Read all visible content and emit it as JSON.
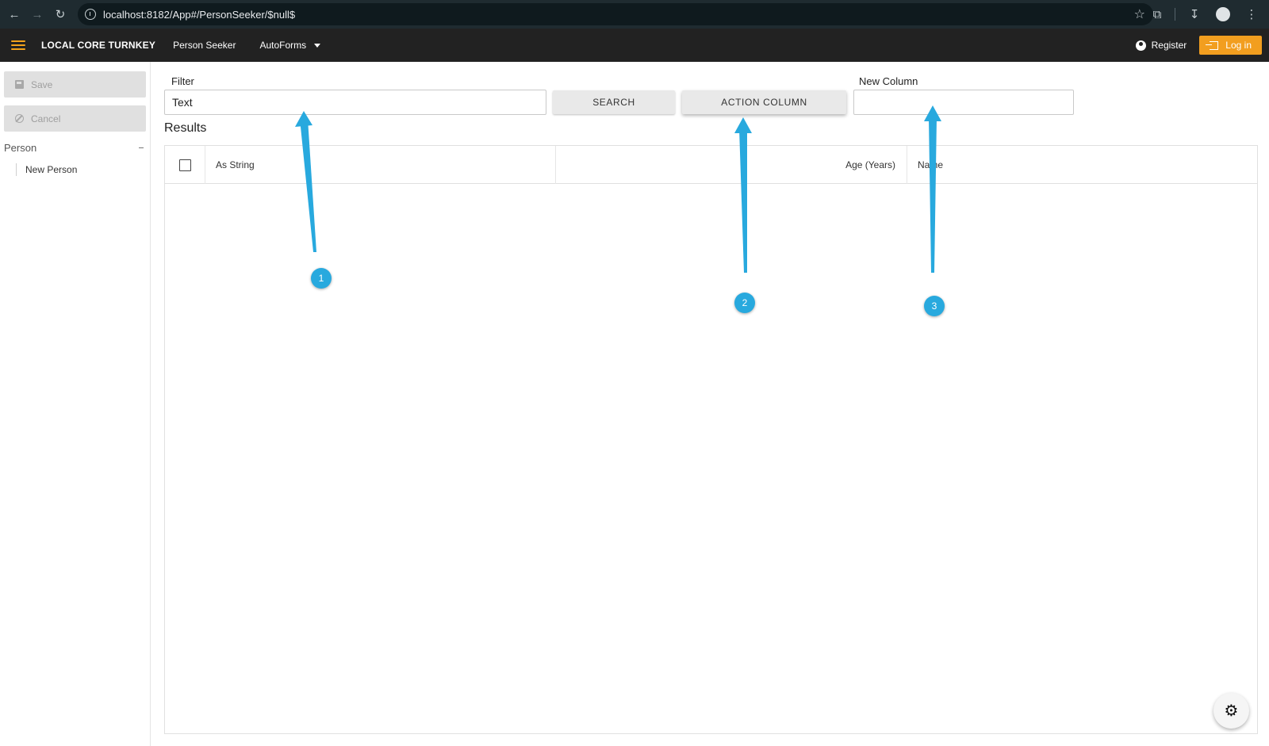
{
  "browser": {
    "url": "localhost:8182/App#/PersonSeeker/$null$",
    "icons": [
      "back-arrow-icon",
      "forward-arrow-icon",
      "reload-icon",
      "site-info-icon",
      "star-icon",
      "extensions-icon",
      "download-icon",
      "profile-icon",
      "more-vert-icon"
    ]
  },
  "appbar": {
    "brand": "LOCAL CORE TURNKEY",
    "nav_person_seeker": "Person Seeker",
    "nav_autoforms": "AutoForms",
    "register": "Register",
    "login": "Log in",
    "accent_color": "#f29e1f"
  },
  "sidebar": {
    "save": "Save",
    "cancel": "Cancel",
    "section": "Person",
    "items": [
      {
        "label": "New Person"
      }
    ]
  },
  "main": {
    "filter_label": "Filter",
    "filter_value": "Text",
    "search_button": "SEARCH",
    "action_column_button": "ACTION COLUMN",
    "new_column_label": "New Column",
    "new_column_value": "",
    "results_title": "Results",
    "columns": [
      "As String",
      "Age (Years)",
      "Name"
    ],
    "rows": []
  },
  "annotations": {
    "color": "#28a9de",
    "markers": [
      "1",
      "2",
      "3"
    ]
  }
}
